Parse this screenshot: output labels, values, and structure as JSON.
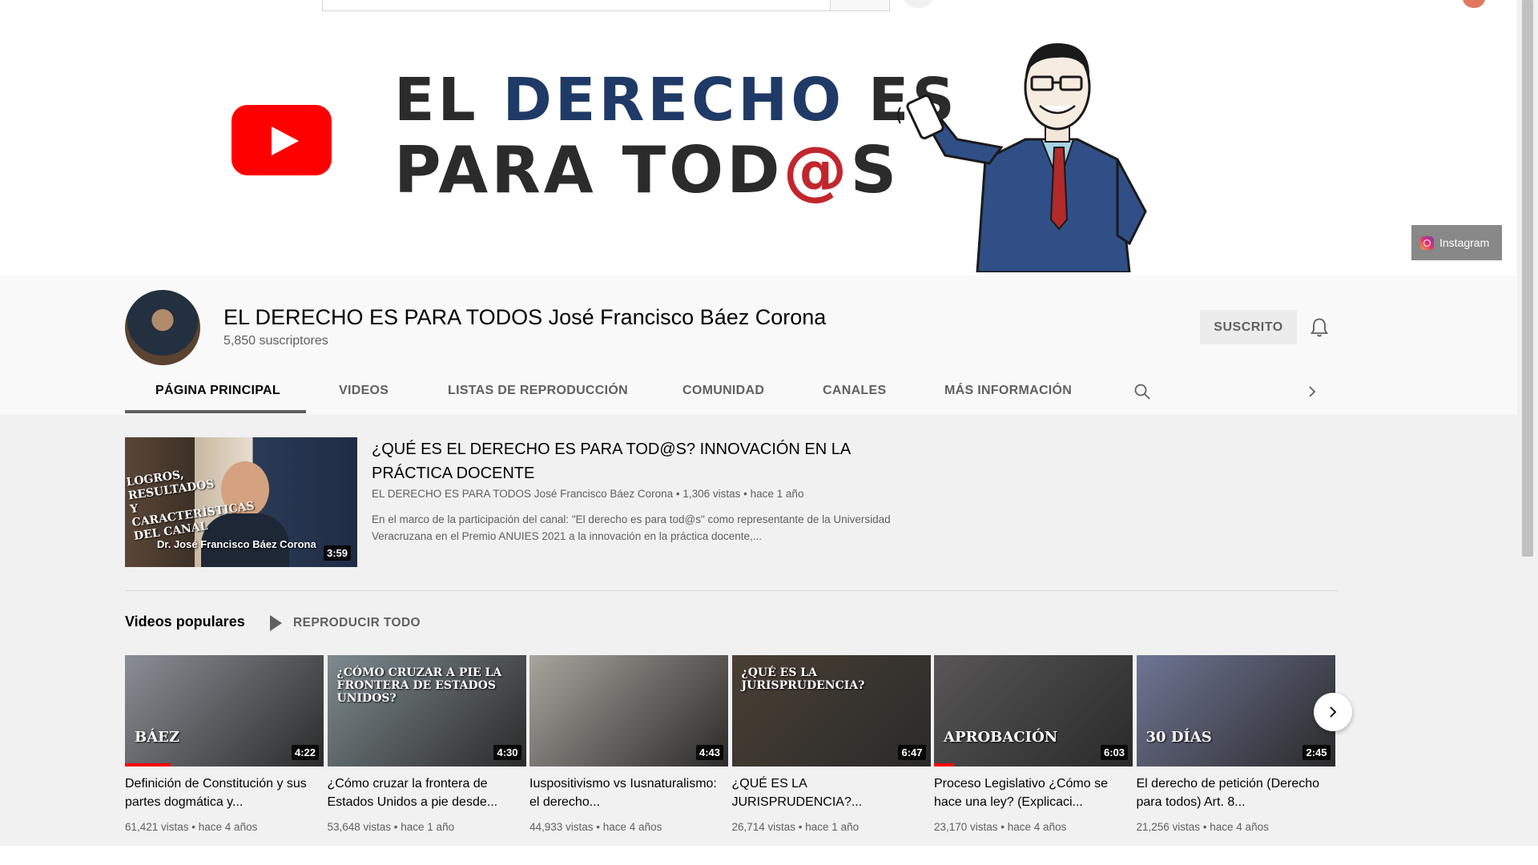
{
  "banner": {
    "line1_a": "EL",
    "line1_b": "DERECHO",
    "line1_c": "ES",
    "line2_a": "PARA TOD",
    "line2_b": "@",
    "line2_c": "S",
    "instagram_label": "Instagram"
  },
  "channel": {
    "title": "EL DERECHO ES PARA TODOS José Francisco Báez Corona",
    "subscribers": "5,850 suscriptores",
    "subscribed_label": "SUSCRITO"
  },
  "tabs": [
    {
      "label": "PÁGINA PRINCIPAL"
    },
    {
      "label": "VIDEOS"
    },
    {
      "label": "LISTAS DE REPRODUCCIÓN"
    },
    {
      "label": "COMUNIDAD"
    },
    {
      "label": "CANALES"
    },
    {
      "label": "MÁS INFORMACIÓN"
    }
  ],
  "featured": {
    "title": "¿QUÉ ES EL DERECHO ES PARA TOD@S? INNOVACIÓN EN LA PRÁCTICA DOCENTE",
    "meta": "EL DERECHO ES PARA TODOS José Francisco Báez Corona • 1,306 vistas • hace 1 año",
    "description": "En el marco de la participación del canal: \"El derecho es para tod@s\" como representante de la Universidad Veracruzana en el Premio ANUIES 2021 a la innovación en la práctica docente,...",
    "duration": "3:59",
    "thumb_text": "LOGROS, RESULTADOS Y CARACTERÍSTICAS DEL CANAL",
    "thumb_name": "Dr. José Francisco Báez Corona"
  },
  "shelf": {
    "title": "Videos populares",
    "play_all": "REPRODUCIR TODO"
  },
  "videos": [
    {
      "title": "Definición de Constitución y sus partes dogmática y...",
      "meta": "61,421 vistas • hace 4 años",
      "duration": "4:22",
      "progress": 0.23,
      "thumb_text": "BÁEZ",
      "bg": "#8a8f96"
    },
    {
      "title": "¿Cómo cruzar la frontera de Estados Unidos a pie desde...",
      "meta": "53,648 vistas • hace 1 año",
      "duration": "4:30",
      "progress": 0,
      "thumb_text": "¿CÓMO CRUZAR A PIE LA FRONTERA DE ESTADOS UNIDOS?",
      "bg": "#7d8a8f"
    },
    {
      "title": "Iuspositivismo vs Iusnaturalismo: el derecho...",
      "meta": "44,933 vistas • hace 4 años",
      "duration": "4:43",
      "progress": 0,
      "thumb_text": "",
      "bg": "#a9a49d"
    },
    {
      "title": "¿QUÉ ES LA JURISPRUDENCIA?...",
      "meta": "26,714 vistas • hace 1 año",
      "duration": "6:47",
      "progress": 0,
      "thumb_text": "¿QUÉ ES LA JURISPRUDENCIA?",
      "bg": "#4a4034"
    },
    {
      "title": "Proceso Legislativo ¿Cómo se hace una ley? (Explicaci...",
      "meta": "23,170 vistas • hace 4 años",
      "duration": "6:03",
      "progress": 0.1,
      "thumb_text": "APROBACIÓN",
      "bg": "#585656"
    },
    {
      "title": "El derecho de petición (Derecho para todos) Art. 8...",
      "meta": "21,256 vistas • hace 4 años",
      "duration": "2:45",
      "progress": 0,
      "thumb_text": "30 DÍAS",
      "bg": "#6f7695"
    }
  ],
  "colors": {
    "accent_red": "#ff0000",
    "banner_blue": "#1f3a66",
    "banner_red": "#c1272d"
  }
}
